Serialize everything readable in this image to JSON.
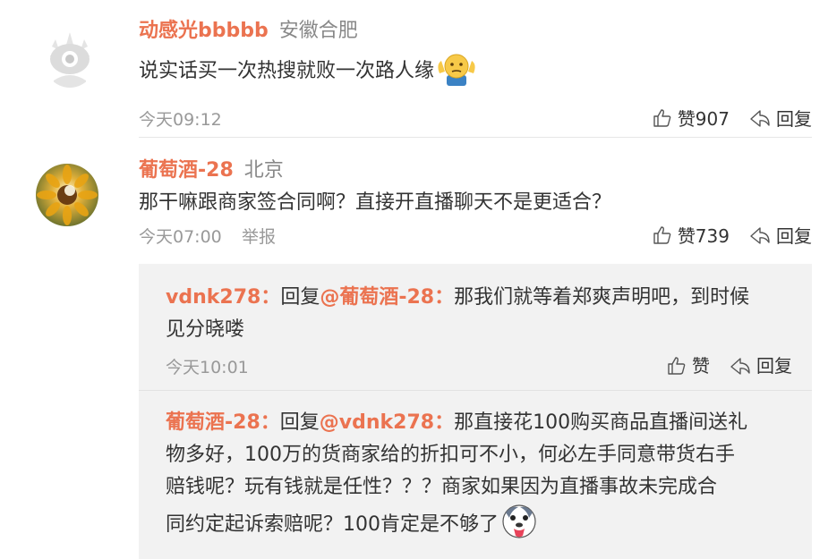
{
  "comments": [
    {
      "username": "动感光bbbbb",
      "location": "安徽合肥",
      "text": "说实话买一次热搜就败一次路人缘",
      "emoji_icon": "shrug-emoji-icon",
      "time": "今天09:12",
      "like_label": "赞907",
      "reply_label": "回复"
    },
    {
      "username": "葡萄酒-28",
      "location": "北京",
      "text": "那干嘛跟商家签合同啊？直接开直播聊天不是更适合？",
      "time": "今天07:00",
      "report_label": "举报",
      "like_label": "赞739",
      "reply_label": "回复"
    }
  ],
  "replies": [
    {
      "author": "vdnk278：",
      "reply_prefix": "回复",
      "target": "@葡萄酒-28：",
      "line1": "那我们就等着郑爽声明吧，到时候",
      "line2": "见分晓喽",
      "time": "今天10:01",
      "like_label": "赞",
      "reply_label": "回复"
    },
    {
      "author": "葡萄酒-28：",
      "reply_prefix": "回复",
      "target": "@vdnk278：",
      "line1": "那直接花100购买商品直播间送礼",
      "line2": "物多好，100万的货商家给的折扣可不小，何必左手同意带货右手",
      "line3": "赔钱呢？玩有钱就是任性？？？商家如果因为直播事故未完成合",
      "line4": "同约定起诉索赔呢？100肯定是不够了",
      "emoji_icon": "doge-tongue-emoji-icon"
    }
  ],
  "colors": {
    "username": "#eb7350",
    "location": "#888888",
    "meta": "#999999",
    "text": "#333333",
    "reply_bg": "#f2f2f2"
  }
}
